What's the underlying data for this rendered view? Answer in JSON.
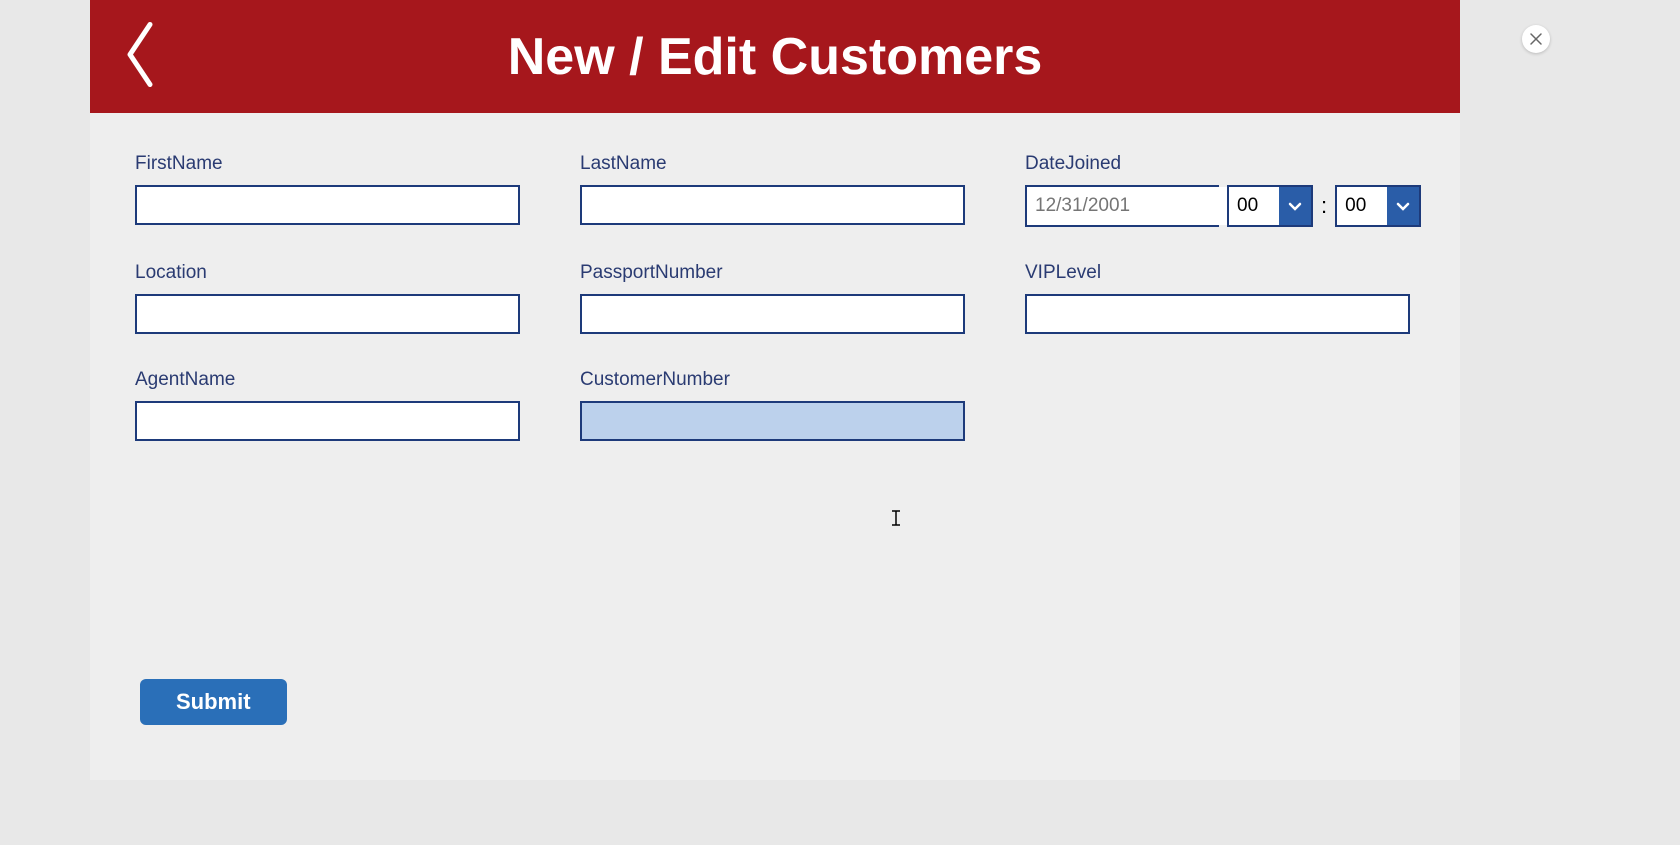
{
  "header": {
    "title": "New / Edit Customers"
  },
  "fields": {
    "firstName": {
      "label": "FirstName",
      "value": ""
    },
    "lastName": {
      "label": "LastName",
      "value": ""
    },
    "dateJoined": {
      "label": "DateJoined",
      "placeholder": "12/31/2001"
    },
    "time": {
      "hour": "00",
      "minute": "00",
      "separator": ":"
    },
    "location": {
      "label": "Location",
      "value": ""
    },
    "passportNumber": {
      "label": "PassportNumber",
      "value": ""
    },
    "vipLevel": {
      "label": "VIPLevel",
      "value": ""
    },
    "agentName": {
      "label": "AgentName",
      "value": ""
    },
    "customerNumber": {
      "label": "CustomerNumber",
      "value": ""
    }
  },
  "buttons": {
    "submit": "Submit"
  },
  "colors": {
    "headerBg": "#a6171c",
    "border": "#1d3a7a",
    "labelText": "#2a3b72",
    "accentBlue": "#2a5da8",
    "submitBlue": "#2a6fb8",
    "focusedBg": "#bcd1ec"
  }
}
